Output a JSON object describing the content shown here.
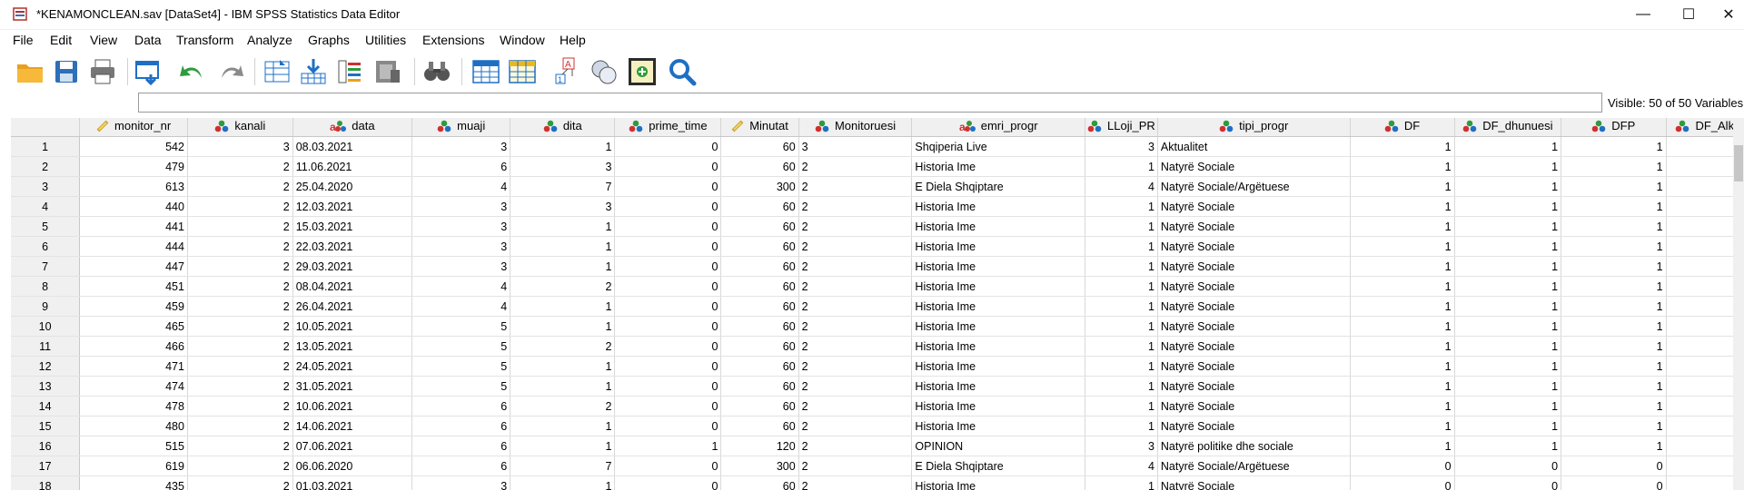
{
  "window": {
    "title": "*KENAMONCLEAN.sav [DataSet4] - IBM SPSS Statistics Data Editor",
    "minimize": "—",
    "maximize": "☐",
    "close": "✕"
  },
  "menu": [
    {
      "label": "File"
    },
    {
      "label": "Edit"
    },
    {
      "label": "View"
    },
    {
      "label": "Data"
    },
    {
      "label": "Transform"
    },
    {
      "label": "Analyze"
    },
    {
      "label": "Graphs"
    },
    {
      "label": "Utilities"
    },
    {
      "label": "Extensions"
    },
    {
      "label": "Window"
    },
    {
      "label": "Help"
    }
  ],
  "toolbar": {
    "icons": [
      "open-folder-icon",
      "save-icon",
      "print-icon",
      "recall-dialog-icon",
      "undo-icon",
      "redo-icon",
      "goto-case-icon",
      "goto-variable-icon",
      "variables-icon",
      "run-descriptives-icon",
      "find-icon",
      "insert-cases-icon",
      "insert-variable-icon",
      "split-file-icon",
      "weight-cases-icon",
      "select-cases-icon",
      "value-labels-icon",
      "search-icon"
    ]
  },
  "cellbar": {
    "value": "",
    "visible_text": "Visible: 50 of 50 Variables"
  },
  "grid": {
    "columns": [
      {
        "name": "monitor_nr",
        "type": "scale"
      },
      {
        "name": "kanali",
        "type": "nominal"
      },
      {
        "name": "data",
        "type": "string"
      },
      {
        "name": "muaji",
        "type": "nominal"
      },
      {
        "name": "dita",
        "type": "nominal"
      },
      {
        "name": "prime_time",
        "type": "nominal"
      },
      {
        "name": "Minutat",
        "type": "scale"
      },
      {
        "name": "Monitoruesi",
        "type": "nominal"
      },
      {
        "name": "emri_progr",
        "type": "string"
      },
      {
        "name": "LLoji_PR",
        "type": "nominal"
      },
      {
        "name": "tipi_progr",
        "type": "nominal"
      },
      {
        "name": "DF",
        "type": "nominal"
      },
      {
        "name": "DF_dhunuesi",
        "type": "nominal"
      },
      {
        "name": "DFP",
        "type": "nominal"
      },
      {
        "name": "DF_Alk",
        "type": "nominal"
      }
    ],
    "rows": [
      [
        "1",
        "542",
        "3",
        "08.03.2021",
        "3",
        "1",
        "0",
        "60",
        "3",
        "Shqiperia Live",
        "3",
        "Aktualitet",
        "1",
        "1",
        "1",
        ""
      ],
      [
        "2",
        "479",
        "2",
        "11.06.2021",
        "6",
        "3",
        "0",
        "60",
        "2",
        "Historia Ime",
        "1",
        "Natyrë Sociale",
        "1",
        "1",
        "1",
        ""
      ],
      [
        "3",
        "613",
        "2",
        "25.04.2020",
        "4",
        "7",
        "0",
        "300",
        "2",
        "E Diela Shqiptare",
        "4",
        "Natyrë Sociale/Argëtuese",
        "1",
        "1",
        "1",
        ""
      ],
      [
        "4",
        "440",
        "2",
        "12.03.2021",
        "3",
        "3",
        "0",
        "60",
        "2",
        "Historia Ime",
        "1",
        "Natyrë Sociale",
        "1",
        "1",
        "1",
        ""
      ],
      [
        "5",
        "441",
        "2",
        "15.03.2021",
        "3",
        "1",
        "0",
        "60",
        "2",
        "Historia Ime",
        "1",
        "Natyrë Sociale",
        "1",
        "1",
        "1",
        ""
      ],
      [
        "6",
        "444",
        "2",
        "22.03.2021",
        "3",
        "1",
        "0",
        "60",
        "2",
        "Historia Ime",
        "1",
        "Natyrë Sociale",
        "1",
        "1",
        "1",
        ""
      ],
      [
        "7",
        "447",
        "2",
        "29.03.2021",
        "3",
        "1",
        "0",
        "60",
        "2",
        "Historia Ime",
        "1",
        "Natyrë Sociale",
        "1",
        "1",
        "1",
        ""
      ],
      [
        "8",
        "451",
        "2",
        "08.04.2021",
        "4",
        "2",
        "0",
        "60",
        "2",
        "Historia Ime",
        "1",
        "Natyrë Sociale",
        "1",
        "1",
        "1",
        ""
      ],
      [
        "9",
        "459",
        "2",
        "26.04.2021",
        "4",
        "1",
        "0",
        "60",
        "2",
        "Historia Ime",
        "1",
        "Natyrë Sociale",
        "1",
        "1",
        "1",
        ""
      ],
      [
        "10",
        "465",
        "2",
        "10.05.2021",
        "5",
        "1",
        "0",
        "60",
        "2",
        "Historia Ime",
        "1",
        "Natyrë Sociale",
        "1",
        "1",
        "1",
        ""
      ],
      [
        "11",
        "466",
        "2",
        "13.05.2021",
        "5",
        "2",
        "0",
        "60",
        "2",
        "Historia Ime",
        "1",
        "Natyrë Sociale",
        "1",
        "1",
        "1",
        ""
      ],
      [
        "12",
        "471",
        "2",
        "24.05.2021",
        "5",
        "1",
        "0",
        "60",
        "2",
        "Historia Ime",
        "1",
        "Natyrë Sociale",
        "1",
        "1",
        "1",
        ""
      ],
      [
        "13",
        "474",
        "2",
        "31.05.2021",
        "5",
        "1",
        "0",
        "60",
        "2",
        "Historia Ime",
        "1",
        "Natyrë Sociale",
        "1",
        "1",
        "1",
        ""
      ],
      [
        "14",
        "478",
        "2",
        "10.06.2021",
        "6",
        "2",
        "0",
        "60",
        "2",
        "Historia Ime",
        "1",
        "Natyrë Sociale",
        "1",
        "1",
        "1",
        ""
      ],
      [
        "15",
        "480",
        "2",
        "14.06.2021",
        "6",
        "1",
        "0",
        "60",
        "2",
        "Historia Ime",
        "1",
        "Natyrë Sociale",
        "1",
        "1",
        "1",
        ""
      ],
      [
        "16",
        "515",
        "2",
        "07.06.2021",
        "6",
        "1",
        "1",
        "120",
        "2",
        "OPINION",
        "3",
        "Natyrë politike dhe sociale",
        "1",
        "1",
        "1",
        ""
      ],
      [
        "17",
        "619",
        "2",
        "06.06.2020",
        "6",
        "7",
        "0",
        "300",
        "2",
        "E Diela Shqiptare",
        "4",
        "Natyrë Sociale/Argëtuese",
        "0",
        "0",
        "0",
        ""
      ],
      [
        "18",
        "435",
        "2",
        "01.03.2021",
        "3",
        "1",
        "0",
        "60",
        "2",
        "Historia Ime",
        "1",
        "Natyrë Sociale",
        "0",
        "0",
        "0",
        ""
      ]
    ]
  },
  "colors": {
    "header_bg": "#f0f0f0",
    "grid_line": "#d9d9d9",
    "accent_blue": "#1e6fc4",
    "undo_green": "#2e9b3e"
  }
}
